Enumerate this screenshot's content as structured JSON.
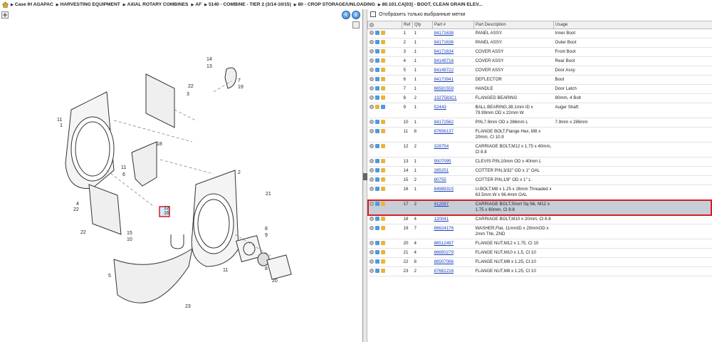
{
  "breadcrumb": {
    "items": [
      "Case IH AGAPAC",
      "HARVESTING EQUIPMENT",
      "AXIAL ROTARY COMBINES",
      "AF",
      "5140 - COMBINE - TIER 2 (3/14-10/15)",
      "80 - CROP STORAGE/UNLOADING",
      "80.101.CA[03] - BOOT, CLEAN GRAIN ELEV..."
    ]
  },
  "filter": {
    "label": "Отобразить только выбранные метки"
  },
  "diagram": {
    "callouts": [
      "14",
      "13",
      "7",
      "19",
      "22",
      "3",
      "11",
      "1",
      "18",
      "11",
      "6",
      "2",
      "4",
      "22",
      "12",
      "16",
      "21",
      "22",
      "15",
      "10",
      "5",
      "11",
      "8",
      "9",
      "8",
      "20",
      "23",
      "17"
    ]
  },
  "table": {
    "headers": [
      "Ref",
      "Qty",
      "Part #",
      "Part Description",
      "Usage"
    ],
    "rows": [
      {
        "ref": "1",
        "qty": "1",
        "part": "84171638",
        "desc": "PANEL ASSY.",
        "usage": "Inner Boot",
        "icons": [
          "g",
          "b",
          "y"
        ]
      },
      {
        "ref": "2",
        "qty": "1",
        "part": "84171636",
        "desc": "PANEL ASSY.",
        "usage": "Outer Boot",
        "icons": [
          "g",
          "b",
          "y"
        ]
      },
      {
        "ref": "3",
        "qty": "1",
        "part": "84171634",
        "desc": "COVER ASSY",
        "usage": "Front Boot",
        "icons": [
          "g",
          "b",
          "y"
        ]
      },
      {
        "ref": "4",
        "qty": "1",
        "part": "84149716",
        "desc": "COVER ASSY",
        "usage": "Rear Boot",
        "icons": [
          "g",
          "b",
          "y"
        ]
      },
      {
        "ref": "5",
        "qty": "1",
        "part": "84149722",
        "desc": "COVER ASSY",
        "usage": "Door Assy",
        "icons": [
          "g",
          "b",
          "y"
        ]
      },
      {
        "ref": "6",
        "qty": "1",
        "part": "84173941",
        "desc": "DEFLECTOR",
        "usage": "Boot",
        "icons": [
          "g",
          "b",
          "y"
        ]
      },
      {
        "ref": "7",
        "qty": "1",
        "part": "86581559",
        "desc": "HANDLE",
        "usage": "Door Latch",
        "icons": [
          "g",
          "b",
          "y"
        ]
      },
      {
        "ref": "8",
        "qty": "2",
        "part": "1327583C1",
        "desc": "FLANGED BEARING",
        "usage": "80mm, 4 Bolt",
        "icons": [
          "g",
          "b",
          "y"
        ]
      },
      {
        "ref": "9",
        "qty": "1",
        "part": "52443",
        "desc": "BALL BEARING,38.1mm ID x 79.99mm OD x 22mm W",
        "usage": "Auger Shaft",
        "icons": [
          "g",
          "y",
          "b"
        ]
      },
      {
        "ref": "10",
        "qty": "1",
        "part": "84172562",
        "desc": "PIN,7.9mm OD x 286mm L",
        "usage": "7.9mm x 286mm",
        "icons": [
          "g",
          "b",
          "y"
        ]
      },
      {
        "ref": "11",
        "qty": "8",
        "part": "87656137",
        "desc": "FLANGE BOLT,Flange Hex, M8 x 20mm, Cl 10.9",
        "usage": "",
        "icons": [
          "g",
          "b",
          "y"
        ]
      },
      {
        "ref": "12",
        "qty": "2",
        "part": "328754",
        "desc": "CARRIAGE BOLT,M12 x 1.75 x 40mm, Cl 8.8",
        "usage": "",
        "icons": [
          "g",
          "b",
          "y"
        ]
      },
      {
        "ref": "13",
        "qty": "1",
        "part": "9507095",
        "desc": "CLEVIS PIN,10mm OD x 40mm L",
        "usage": "",
        "icons": [
          "g",
          "b",
          "y"
        ]
      },
      {
        "ref": "14",
        "qty": "1",
        "part": "285251",
        "desc": "COTTER PIN,3/32\" OD x 1\" OAL",
        "usage": "",
        "icons": [
          "g",
          "b",
          "y"
        ]
      },
      {
        "ref": "15",
        "qty": "2",
        "part": "80755",
        "desc": "COTTER PIN,1/8\" OD x 1\" L",
        "usage": "",
        "icons": [
          "g",
          "b",
          "y"
        ]
      },
      {
        "ref": "16",
        "qty": "1",
        "part": "84989315",
        "desc": "U-BOLT,M8 x 1.25 x 26mm Threaded x 63.5mm W x 96.4mm OAL",
        "usage": "",
        "icons": [
          "g",
          "b",
          "y"
        ]
      },
      {
        "ref": "17",
        "qty": "2",
        "part": "412097",
        "desc": "CARRIAGE BOLT,Short Sq Nk, M12 x 1.75 x 60mm, Cl 8.8",
        "usage": "",
        "icons": [
          "g",
          "b",
          "y"
        ],
        "selected": true
      },
      {
        "ref": "18",
        "qty": "4",
        "part": "120041",
        "desc": "CARRIAGE BOLT,M10 x 20mm, Cl 8.8",
        "usage": "",
        "icons": [
          "g",
          "b",
          "y"
        ]
      },
      {
        "ref": "19",
        "qty": "7",
        "part": "86624176",
        "desc": "WASHER,Flat, 11mmID x 20mmOD x 2mm Thk, ZND",
        "usage": "",
        "icons": [
          "g",
          "b",
          "y"
        ]
      },
      {
        "ref": "20",
        "qty": "4",
        "part": "86512497",
        "desc": "FLANGE NUT,M12 x 1.75, Cl 10",
        "usage": "",
        "icons": [
          "g",
          "b",
          "y"
        ]
      },
      {
        "ref": "21",
        "qty": "4",
        "part": "86650279",
        "desc": "FLANGE NUT,M10 x 1.5, Cl 10",
        "usage": "",
        "icons": [
          "g",
          "b",
          "y"
        ]
      },
      {
        "ref": "22",
        "qty": "8",
        "part": "86507066",
        "desc": "FLANGE NUT,M8 x 1.25, Cl 10",
        "usage": "",
        "icons": [
          "g",
          "b",
          "y"
        ]
      },
      {
        "ref": "23",
        "qty": "2",
        "part": "87681216",
        "desc": "FLANGE NUT,M8 x 1.25, Cl 10",
        "usage": "",
        "icons": [
          "g",
          "b",
          "y"
        ]
      }
    ]
  },
  "colors": {
    "link": "#1a3fbf",
    "selected_row": "#c7ced8",
    "highlight_border": "#d32020"
  }
}
